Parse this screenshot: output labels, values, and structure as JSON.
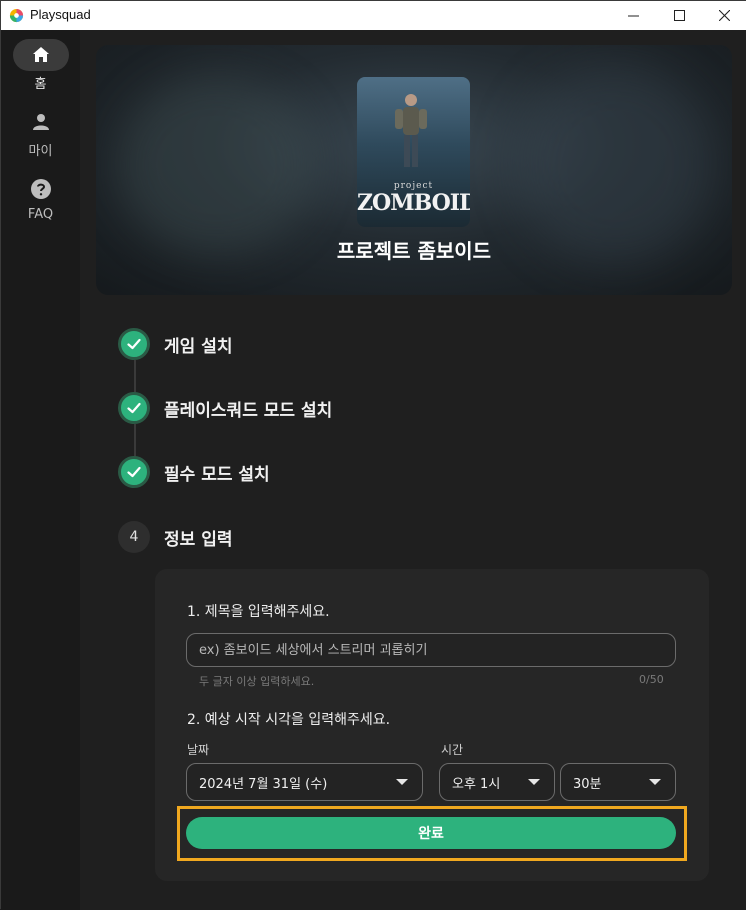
{
  "window": {
    "title": "Playsquad",
    "minimize": "—",
    "maximize": "☐",
    "close": "✕"
  },
  "sidebar": {
    "items": [
      {
        "label": "홈",
        "icon": "home-icon",
        "active": true
      },
      {
        "label": "마이",
        "icon": "person-icon",
        "active": false
      },
      {
        "label": "FAQ",
        "icon": "help-icon",
        "active": false
      }
    ]
  },
  "game": {
    "title": "프로젝트 좀보이드",
    "cover_brand_small": "project",
    "cover_brand": "ZOMBOID"
  },
  "steps": [
    {
      "label": "게임 설치",
      "status": "done"
    },
    {
      "label": "플레이스쿼드 모드 설치",
      "status": "done"
    },
    {
      "label": "필수 모드 설치",
      "status": "done"
    },
    {
      "label": "정보 입력",
      "status": "current",
      "number": "4"
    }
  ],
  "form": {
    "q1": "1. 제목을 입력해주세요.",
    "title_placeholder": "ex) 좀보이드 세상에서 스트리머 괴롭히기",
    "title_value": "",
    "hint": "두 글자 이상 입력하세요.",
    "counter": "0/50",
    "q2": "2. 예상 시작 시각을 입력해주세요.",
    "date_label": "날짜",
    "time_label": "시간",
    "date_value": "2024년 7월 31일 (수)",
    "hour_value": "오후 1시",
    "minute_value": "30분",
    "submit_label": "완료"
  },
  "colors": {
    "accent": "#2db27d",
    "highlight": "#f0a81f",
    "background": "#1f1f1f",
    "card": "#262626"
  }
}
